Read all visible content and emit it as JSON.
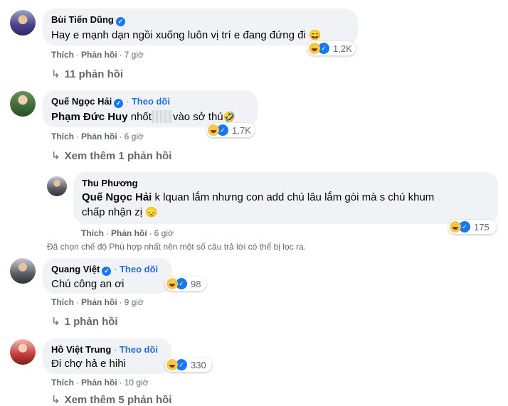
{
  "comments": [
    {
      "name": "Bùi Tiến Dũng",
      "verified": true,
      "text": "Hay e mạnh dạn ngồi xuống luôn vị trí e đang đứng đi",
      "emoji": "😄",
      "like_label": "Thích",
      "reply_label": "Phản hồi",
      "time": "7 giờ",
      "reaction_count": "1,2K",
      "replies_label": "11 phản hồi"
    },
    {
      "name": "Quế Ngọc Hải",
      "verified": true,
      "follow": "Theo dõi",
      "mention": "Phạm Đức Huy",
      "text_before": "nhốt",
      "text_after": "vào sở thú",
      "emoji": "🤣",
      "like_label": "Thích",
      "reply_label": "Phản hồi",
      "time": "6 giờ",
      "reaction_count": "1,7K",
      "replies_label": "Xem thêm 1 phản hồi"
    },
    {
      "name": "Thu Phương",
      "mention": "Quế Ngọc Hải",
      "text_line1": "k lquan lắm nhưng con add chú lâu lắm gòi mà s chú khum",
      "text_line2": "chấp nhận zị",
      "emoji": "😞",
      "like_label": "Thích",
      "reply_label": "Phản hồi",
      "time": "6 giờ",
      "reaction_count": "175"
    },
    {
      "name": "Quang Việt",
      "verified": true,
      "follow": "Theo dõi",
      "text": "Chú công an ơi",
      "like_label": "Thích",
      "reply_label": "Phản hồi",
      "time": "9 giờ",
      "reaction_count": "98",
      "replies_label": "1 phản hồi"
    },
    {
      "name": "Hồ Việt Trung",
      "follow": "Theo dõi",
      "text": "Đi chợ hả e hihi",
      "like_label": "Thích",
      "reply_label": "Phản hồi",
      "time": "10 giờ",
      "reaction_count": "330",
      "replies_label": "Xem thêm 5 phản hồi"
    }
  ],
  "filter_notice": "Đã chọn chế độ Phù hợp nhất nên một số câu trả lời có thể bị lọc ra.",
  "icons": {
    "reply_arrow": "↳",
    "verified": "✓",
    "like": "👍"
  },
  "colors": {
    "link": "#216fdb",
    "bubble": "#f0f2f5",
    "meta": "#65676b"
  }
}
